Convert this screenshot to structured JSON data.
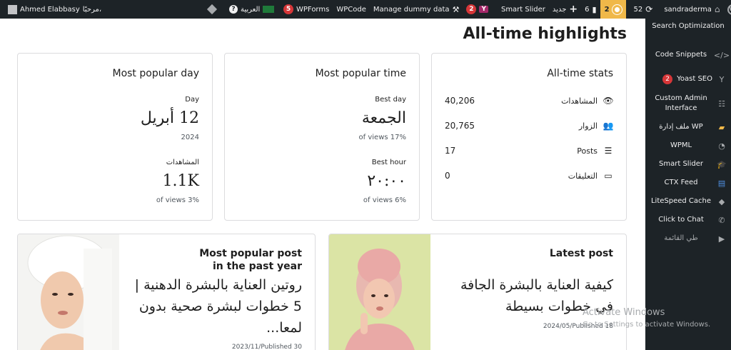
{
  "adminbar": {
    "user_name": "Ahmed Elabbasy",
    "greeting": "مرحبًا،",
    "language": "العربية",
    "wpforms_count": "5",
    "wpforms_label": "WPForms",
    "wpcode_label": "WPCode",
    "dummy_label": "Manage dummy data",
    "yoast_count": "2",
    "smart_slider_label": "Smart Slider",
    "new_label": "جديد",
    "comments_count": "6",
    "updates_count": "2",
    "sync_count": "52",
    "site_name": "sandraderma"
  },
  "page": {
    "title": "All-time highlights"
  },
  "alltime_stats": {
    "title": "All-time stats",
    "rows": [
      {
        "label": "المشاهدات",
        "value": "40,206",
        "icon": "eye-icon"
      },
      {
        "label": "الزوار",
        "value": "20,765",
        "icon": "people-icon"
      },
      {
        "label": "Posts",
        "value": "17",
        "icon": "list-icon"
      },
      {
        "label": "التعليقات",
        "value": "0",
        "icon": "comment-icon"
      }
    ]
  },
  "popular_time": {
    "title": "Most popular time",
    "best_day_label": "Best day",
    "best_day_value": "الجمعة",
    "best_day_sub": "of views 17%",
    "best_hour_label": "Best hour",
    "best_hour_value": "٢٠:٠٠",
    "best_hour_sub": "of views 6%"
  },
  "popular_day": {
    "title": "Most popular day",
    "day_label": "Day",
    "day_value": "12 أبريل",
    "year": "2024",
    "views_label": "المشاهدات",
    "views_value": "1.1K",
    "views_sub": "of views 3%"
  },
  "latest_post": {
    "heading": "Latest post",
    "title": "كيفية العناية بالبشرة الجافة في خطوات بسيطة",
    "date": "2024/05/Published 18"
  },
  "popular_post": {
    "heading_line1": "Most popular post",
    "heading_line2": "in the past year",
    "title": "روتين العناية بالبشرة الدهنية | 5 خطوات لبشرة صحية بدون لمعا...",
    "date": "2023/11/Published 30"
  },
  "sidebar": {
    "items": [
      {
        "label": "Search Optimization",
        "icon": "search-seo-icon"
      },
      {
        "label": "Code Snippets",
        "icon": "code-icon"
      },
      {
        "label": "Yoast SEO",
        "badge": "2",
        "icon": "yoast-icon"
      },
      {
        "label": "Custom Admin Interface",
        "icon": "sliders-icon"
      },
      {
        "label": "ملف إدارة WP",
        "icon": "folder-icon"
      },
      {
        "label": "WPML",
        "icon": "wpml-icon"
      },
      {
        "label": "Smart Slider",
        "icon": "graduation-icon"
      },
      {
        "label": "CTX Feed",
        "icon": "feed-icon"
      },
      {
        "label": "LiteSpeed Cache",
        "icon": "diamond-icon"
      },
      {
        "label": "Click to Chat",
        "icon": "whatsapp-icon"
      },
      {
        "label": "طي القائمة",
        "icon": "collapse-icon"
      }
    ]
  },
  "watermark": {
    "line1": "Activate Windows",
    "line2": "Go to Settings to activate Windows."
  },
  "colors": {
    "adminbar": "#1d2327",
    "accent_red": "#d63638",
    "accent_orange": "#f0b849"
  }
}
